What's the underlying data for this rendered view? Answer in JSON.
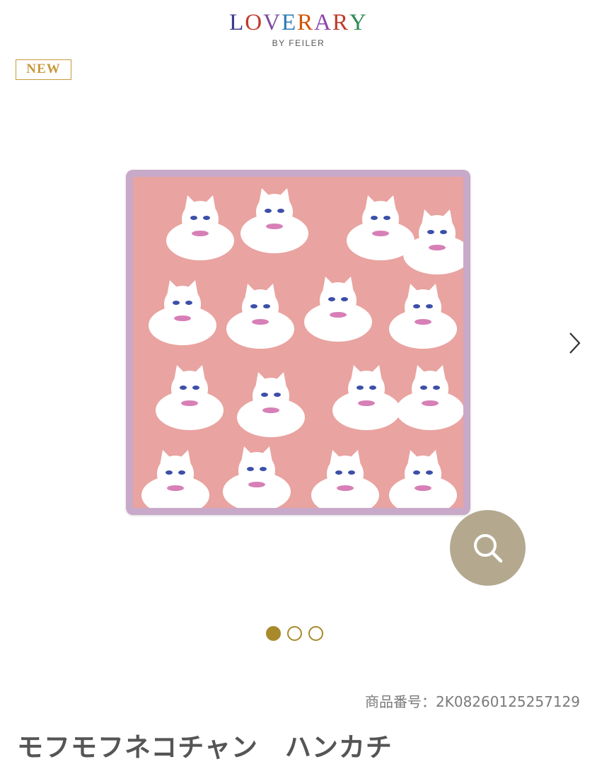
{
  "brand": {
    "logo_letters": [
      "L",
      "O",
      "V",
      "E",
      "R",
      "A",
      "R",
      "Y"
    ],
    "logo_colors": [
      "#3a3a8c",
      "#c0392b",
      "#7c4da0",
      "#2c7bb6",
      "#d35400",
      "#8e44ad",
      "#c0392b",
      "#2e8b57"
    ],
    "sub": "BY FEILER"
  },
  "badge": {
    "label": "NEW"
  },
  "gallery": {
    "image_alt": "pink handkerchief with white cat pattern",
    "current_page": 1,
    "total_pages": 3,
    "colors": {
      "towel": "#e9a3a0",
      "border": "#c8a9c9",
      "cat": "#ffffff",
      "eyes": "#3c4fa8",
      "bow": "#d77fb7"
    }
  },
  "product": {
    "code_label": "商品番号：2K08260125257129",
    "title": "モフモフネコチャン　ハンカチ"
  },
  "icons": {
    "next": "chevron-right-icon",
    "zoom": "magnifier-icon"
  },
  "colors": {
    "accent": "#a88a2c",
    "badge": "#c69a3b",
    "zoom_bg": "#b4a98f"
  }
}
